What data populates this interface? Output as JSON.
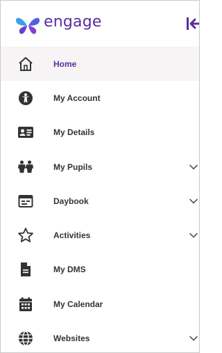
{
  "brand": {
    "name": "engage",
    "color": "#5a2ca0"
  },
  "header": {
    "collapse_icon": "collapse-left-icon"
  },
  "nav": {
    "items": [
      {
        "label": "Home",
        "icon": "home-icon",
        "active": true,
        "expandable": false
      },
      {
        "label": "My Account",
        "icon": "account-icon",
        "active": false,
        "expandable": false
      },
      {
        "label": "My Details",
        "icon": "id-card-icon",
        "active": false,
        "expandable": false
      },
      {
        "label": "My Pupils",
        "icon": "pupils-icon",
        "active": false,
        "expandable": true
      },
      {
        "label": "Daybook",
        "icon": "daybook-icon",
        "active": false,
        "expandable": true
      },
      {
        "label": "Activities",
        "icon": "star-icon",
        "active": false,
        "expandable": true
      },
      {
        "label": "My DMS",
        "icon": "document-icon",
        "active": false,
        "expandable": false
      },
      {
        "label": "My Calendar",
        "icon": "calendar-icon",
        "active": false,
        "expandable": false
      },
      {
        "label": "Websites",
        "icon": "globe-icon",
        "active": false,
        "expandable": true
      }
    ]
  }
}
